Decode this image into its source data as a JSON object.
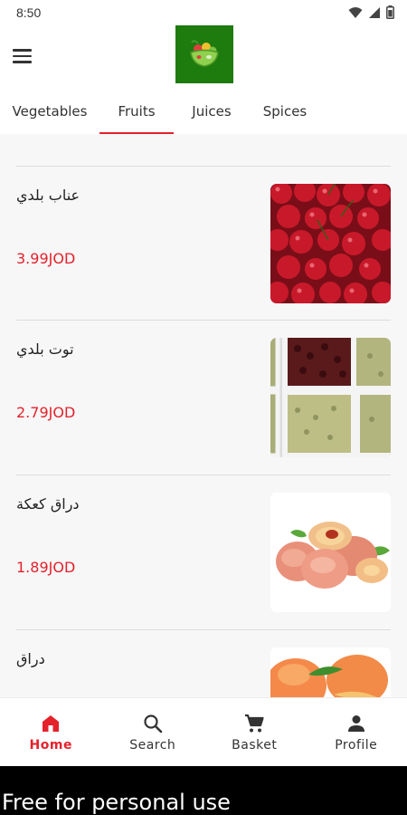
{
  "status_bar": {
    "time": "8:50"
  },
  "tabs": [
    {
      "label": "Vegetables",
      "active": false
    },
    {
      "label": "Fruits",
      "active": true
    },
    {
      "label": "Juices",
      "active": false
    },
    {
      "label": "Spices",
      "active": false
    }
  ],
  "products": [
    {
      "name": "عناب بلدي",
      "price": "3.99JOD",
      "image": "cherries"
    },
    {
      "name": "توت بلدي",
      "price": "2.79JOD",
      "image": "mulberry-crates"
    },
    {
      "name": "دراق كعكة",
      "price": "1.89JOD",
      "image": "flat-peaches"
    },
    {
      "name": "دراق",
      "price": "",
      "image": "peaches"
    }
  ],
  "bottom_nav": [
    {
      "label": "Home",
      "icon": "home-icon",
      "active": true
    },
    {
      "label": "Search",
      "icon": "search-icon",
      "active": false
    },
    {
      "label": "Basket",
      "icon": "cart-icon",
      "active": false
    },
    {
      "label": "Profile",
      "icon": "person-icon",
      "active": false
    }
  ],
  "watermark": {
    "text": "Free for personal use"
  },
  "colors": {
    "accent": "#e4222c",
    "logo_bg": "#1e7b0e",
    "content_bg": "#f7f7f7"
  }
}
